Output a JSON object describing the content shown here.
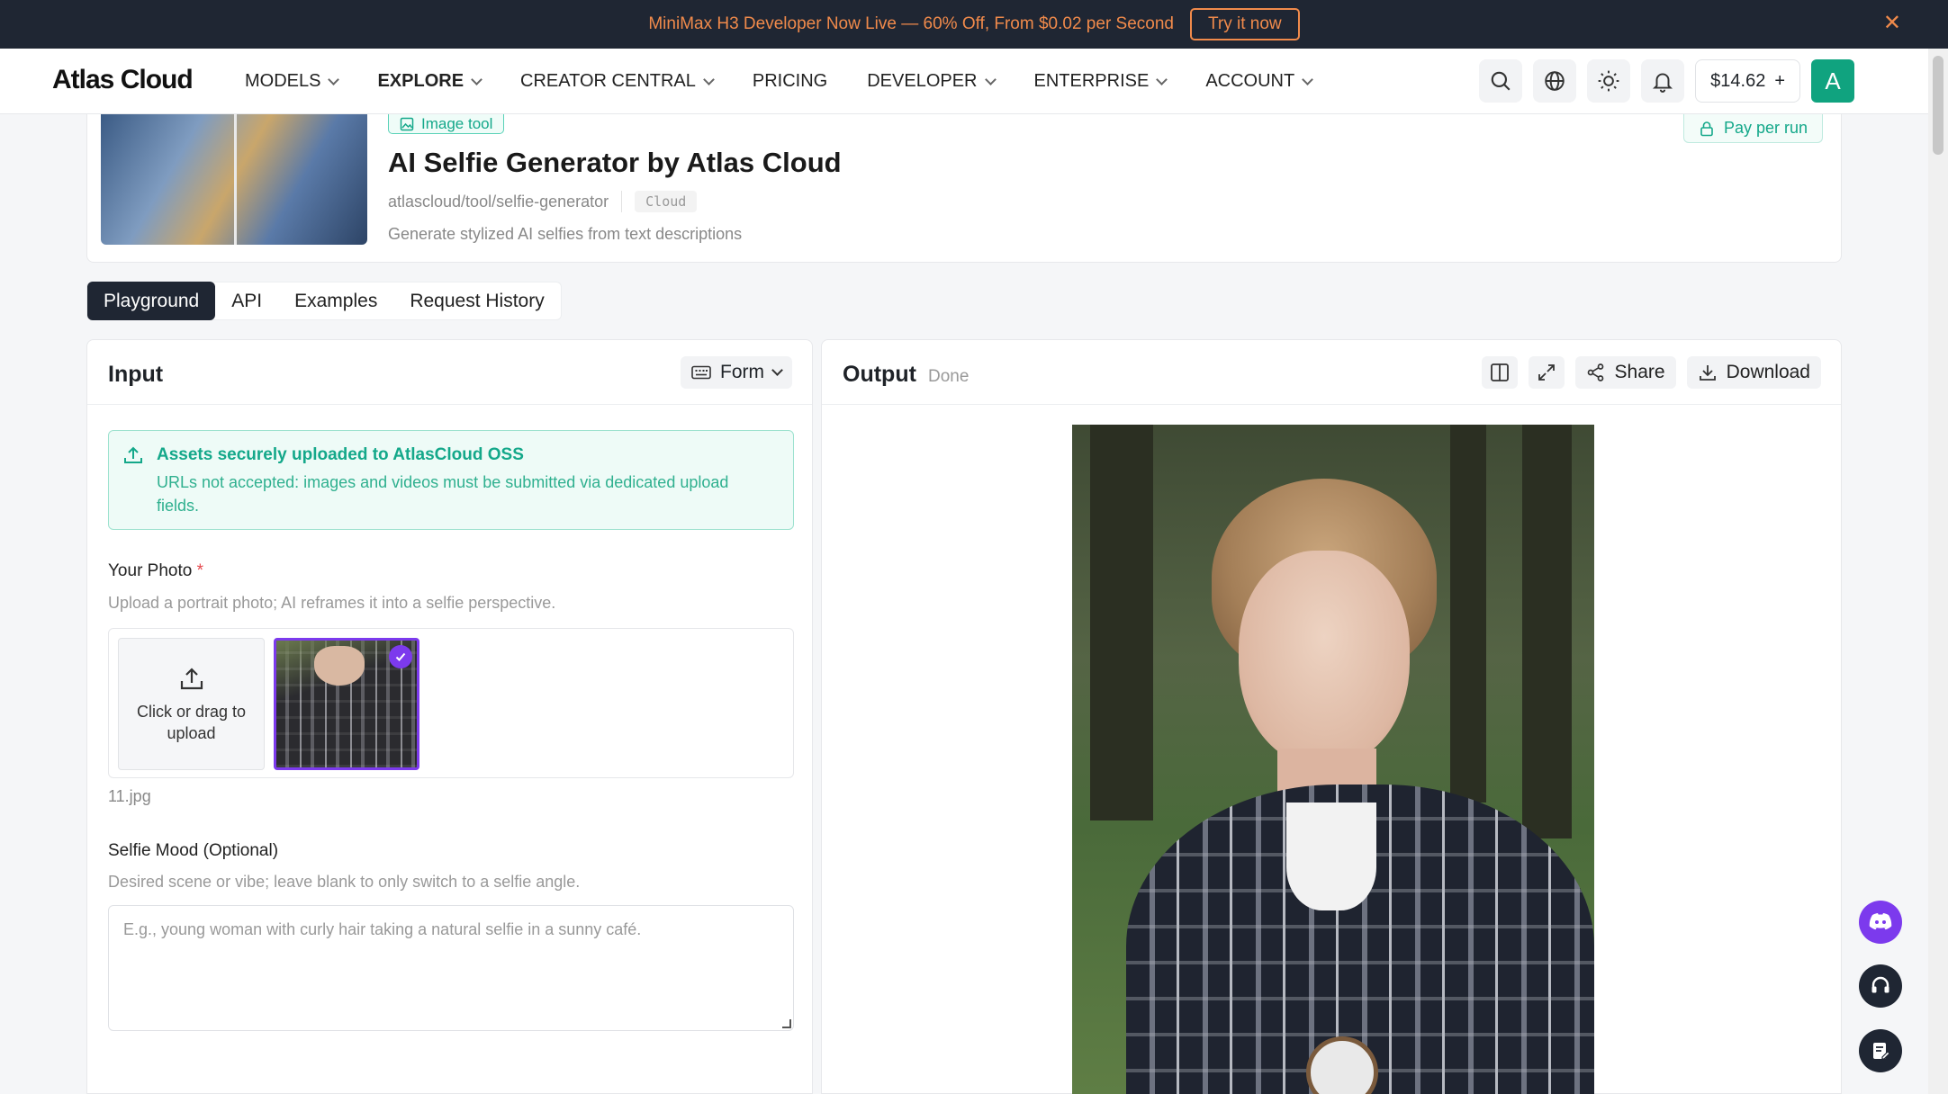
{
  "promo": {
    "text": "MiniMax H3 Developer Now Live — 60% Off, From $0.02 per Second",
    "cta": "Try it now",
    "close": "✕"
  },
  "nav": {
    "logo": "Atlas Cloud",
    "items": [
      {
        "label": "MODELS",
        "dropdown": true
      },
      {
        "label": "EXPLORE",
        "dropdown": true,
        "active": true
      },
      {
        "label": "CREATOR CENTRAL",
        "dropdown": true
      },
      {
        "label": "PRICING",
        "dropdown": false
      },
      {
        "label": "DEVELOPER",
        "dropdown": true
      },
      {
        "label": "ENTERPRISE",
        "dropdown": true
      },
      {
        "label": "ACCOUNT",
        "dropdown": true
      }
    ],
    "balance": "$14.62",
    "balance_add": "+",
    "avatar_letter": "A"
  },
  "tool": {
    "badge": "Image tool",
    "title": "AI Selfie Generator by Atlas Cloud",
    "slug": "atlascloud/tool/selfie-generator",
    "tag": "Cloud",
    "description": "Generate stylized AI selfies from text descriptions",
    "pay_label": "Pay per run"
  },
  "tabs": [
    {
      "label": "Playground",
      "active": true
    },
    {
      "label": "API"
    },
    {
      "label": "Examples"
    },
    {
      "label": "Request History"
    }
  ],
  "input": {
    "title": "Input",
    "mode": "Form",
    "notice": {
      "title": "Assets securely uploaded to AtlasCloud OSS",
      "body": "URLs not accepted: images and videos must be submitted via dedicated upload fields."
    },
    "photo": {
      "label": "Your Photo",
      "required": "*",
      "hint": "Upload a portrait photo; AI reframes it into a selfie perspective.",
      "upload_text": "Click or drag to upload",
      "filename": "11.jpg"
    },
    "mood": {
      "label": "Selfie Mood (Optional)",
      "hint": "Desired scene or vibe; leave blank to only switch to a selfie angle.",
      "placeholder": "E.g., young woman with curly hair taking a natural selfie in a sunny café.",
      "value": ""
    }
  },
  "output": {
    "title": "Output",
    "status": "Done",
    "share": "Share",
    "download": "Download"
  },
  "colors": {
    "accent_green": "#14a88a",
    "accent_purple": "#7c3aed",
    "promo_orange": "#f08a4b",
    "dark": "#1f2633"
  }
}
